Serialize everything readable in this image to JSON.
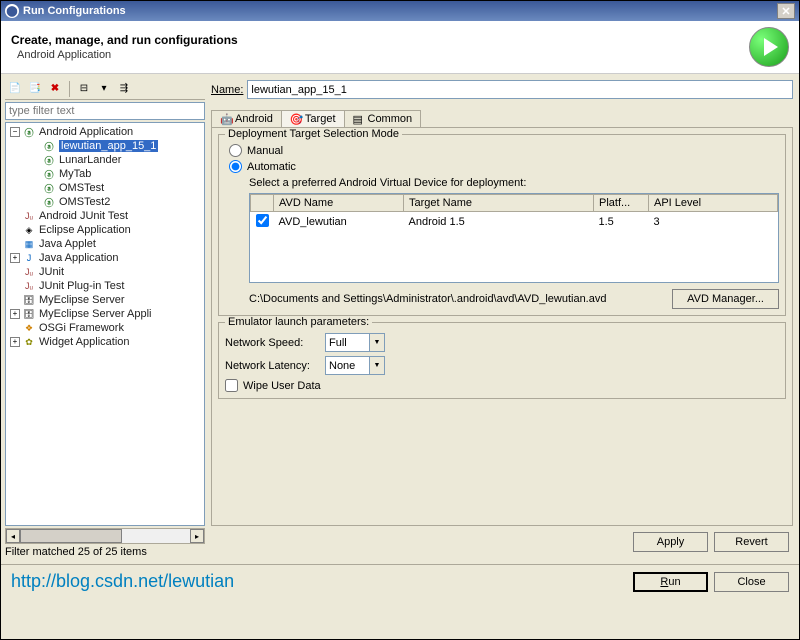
{
  "titlebar": {
    "title": "Run Configurations"
  },
  "header": {
    "title": "Create, manage, and run configurations",
    "subtitle": "Android Application"
  },
  "left": {
    "filter_placeholder": "type filter text",
    "filter_status": "Filter matched 25 of 25 items",
    "tree": {
      "android_app": "Android Application",
      "children": [
        "lewutian_app_15_1",
        "LunarLander",
        "MyTab",
        "OMSTest",
        "OMSTest2"
      ],
      "others": [
        "Android JUnit Test",
        "Eclipse Application",
        "Java Applet",
        "Java Application",
        "JUnit",
        "JUnit Plug-in Test",
        "MyEclipse Server",
        "MyEclipse Server Appli",
        "OSGi Framework",
        "Widget Application"
      ]
    }
  },
  "right": {
    "name_label": "Name:",
    "name_value": "lewutian_app_15_1",
    "tabs": {
      "android": "Android",
      "target": "Target",
      "common": "Common"
    },
    "deployment": {
      "legend": "Deployment Target Selection Mode",
      "manual": "Manual",
      "automatic": "Automatic",
      "select_label": "Select a preferred Android Virtual Device for deployment:",
      "table": {
        "headers": [
          "AVD Name",
          "Target Name",
          "Platf...",
          "API Level"
        ],
        "rows": [
          {
            "checked": true,
            "name": "AVD_lewutian",
            "target": "Android 1.5",
            "platform": "1.5",
            "api": "3"
          }
        ]
      },
      "path": "C:\\Documents and Settings\\Administrator\\.android\\avd\\AVD_lewutian.avd",
      "avd_manager_btn": "AVD Manager..."
    },
    "emulator": {
      "legend": "Emulator launch parameters:",
      "network_speed": {
        "label": "Network Speed:",
        "value": "Full"
      },
      "network_latency": {
        "label": "Network Latency:",
        "value": "None"
      },
      "wipe_data": "Wipe User Data"
    },
    "apply_btn": "Apply",
    "revert_btn": "Revert"
  },
  "footer": {
    "url": "http://blog.csdn.net/lewutian",
    "run_btn": "Run",
    "close_btn": "Close"
  }
}
